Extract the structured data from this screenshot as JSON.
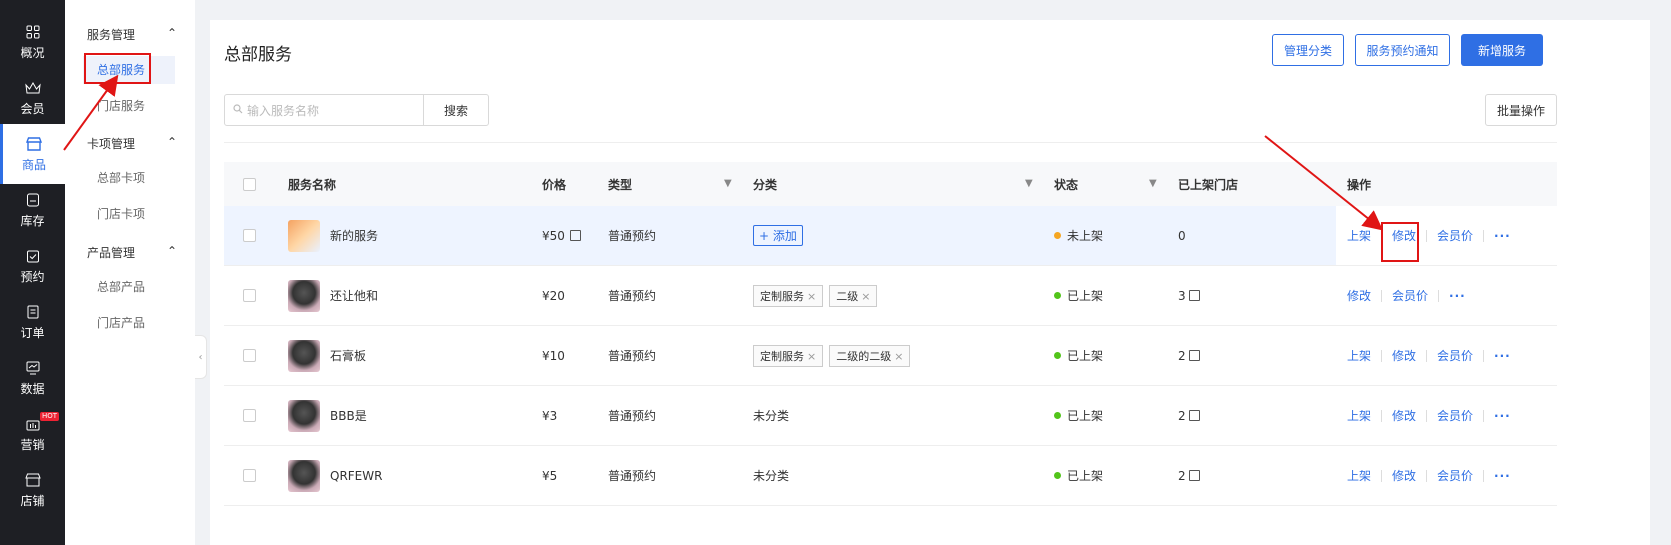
{
  "nav": [
    {
      "label": "概况",
      "icon": "grid-icon"
    },
    {
      "label": "会员",
      "icon": "crown-icon"
    },
    {
      "label": "商品",
      "icon": "store-icon"
    },
    {
      "label": "库存",
      "icon": "inventory-icon"
    },
    {
      "label": "预约",
      "icon": "calendar-check-icon"
    },
    {
      "label": "订单",
      "icon": "order-icon"
    },
    {
      "label": "数据",
      "icon": "chart-icon"
    },
    {
      "label": "营销",
      "icon": "marketing-icon",
      "badge": "HOT"
    },
    {
      "label": "店铺",
      "icon": "shop-icon"
    }
  ],
  "subnav": {
    "groups": [
      {
        "title": "服务管理",
        "items": [
          "总部服务",
          "门店服务"
        ]
      },
      {
        "title": "卡项管理",
        "items": [
          "总部卡项",
          "门店卡项"
        ]
      },
      {
        "title": "产品管理",
        "items": [
          "总部产品",
          "门店产品"
        ]
      }
    ],
    "collapse_icon": "‹"
  },
  "page": {
    "title": "总部服务",
    "buttons": {
      "manage_category": "管理分类",
      "booking_notice": "服务预约通知",
      "add_service": "新增服务"
    },
    "search_placeholder": "输入服务名称",
    "search_button": "搜索",
    "batch_button": "批量操作"
  },
  "table": {
    "headers": {
      "name": "服务名称",
      "price": "价格",
      "type": "类型",
      "category": "分类",
      "status": "状态",
      "stores": "已上架门店",
      "ops": "操作"
    },
    "add_label": "添加",
    "ops_labels": {
      "publish": "上架",
      "edit": "修改",
      "member_price": "会员价",
      "more": "···"
    },
    "rows": [
      {
        "name": "新的服务",
        "price": "¥50",
        "type": "普通预约",
        "category_tags": [],
        "category_text": "",
        "has_add": true,
        "status": "未上架",
        "status_color": "#f5a623",
        "stores": "0",
        "ops": [
          "上架",
          "修改",
          "会员价"
        ]
      },
      {
        "name": "还让他和",
        "price": "¥20",
        "type": "普通预约",
        "category_tags": [
          "定制服务",
          "二级"
        ],
        "category_text": "",
        "has_add": false,
        "status": "已上架",
        "status_color": "#52c41a",
        "stores": "3",
        "ops": [
          "修改",
          "会员价"
        ]
      },
      {
        "name": "石膏板",
        "price": "¥10",
        "type": "普通预约",
        "category_tags": [
          "定制服务",
          "二级的二级"
        ],
        "category_text": "",
        "has_add": false,
        "status": "已上架",
        "status_color": "#52c41a",
        "stores": "2",
        "ops": [
          "上架",
          "修改",
          "会员价"
        ]
      },
      {
        "name": "BBB是",
        "price": "¥3",
        "type": "普通预约",
        "category_tags": [],
        "category_text": "未分类",
        "has_add": false,
        "status": "已上架",
        "status_color": "#52c41a",
        "stores": "2",
        "ops": [
          "上架",
          "修改",
          "会员价"
        ]
      },
      {
        "name": "QRFEWR",
        "price": "¥5",
        "type": "普通预约",
        "category_tags": [],
        "category_text": "未分类",
        "has_add": false,
        "status": "已上架",
        "status_color": "#52c41a",
        "stores": "2",
        "ops": [
          "上架",
          "修改",
          "会员价"
        ]
      }
    ]
  },
  "colors": {
    "accent": "#2f6fe4",
    "annotation": "#e01515"
  }
}
